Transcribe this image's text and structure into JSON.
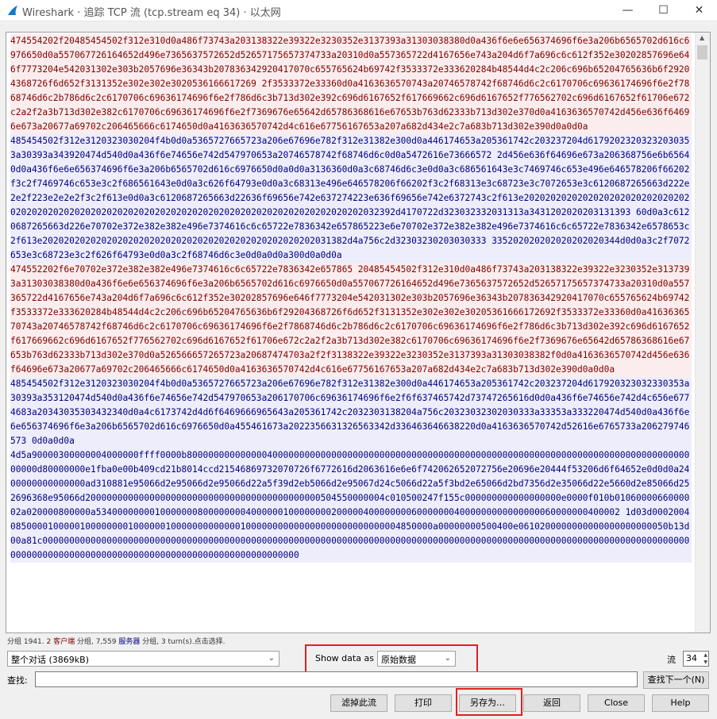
{
  "window": {
    "title": "Wireshark · 追踪 TCP 流 (tcp.stream eq 34) · 以太网",
    "minimize": "—",
    "maximize": "☐",
    "close": "✕"
  },
  "segments": [
    {
      "dir": "client",
      "text": "474554202f20485454502f312e310d0a486f73743a203138322e39322e3230352e3137393a31303038380d0a436f6e6e656374696f6e3a206b6565702d616c6976650d0a557067726164652d496e7365637572652d52657175657374733a20310d0a557365722d4167656e743a204d6f7a696c6c612f352e30202857696e646f7773204e542031302e303b2057696e36343b207836342920417070c655765624b69742f3533372e333620284b48544d4c2c206c696b65204765636b6f29204368726f6d652f3131352e302e302e3020536166617269 2f3533372e33360d0a4163636570743a20746578742f68746d6c2c6170706c69636174696f6e2f7868746d6c2b786d6c2c6170706c69636174696f6e2f786d6c3b713d302e392c696d6167652f617669662c696d6167652f776562702c696d6167652f61706e672c2a2f2a3b713d302e382c6170706c69636174696f6e2f7369676e65642d65786368616e67653b763d62333b713d302e370d0a4163636570742d456e636f64696e673a20677a69702c206465666c6174650d0a4163636570742d4c616e67756167653a207a682d434e2c7a683b713d302e390d0a0d0a"
    },
    {
      "dir": "server",
      "text": "485454502f312e3120323030204f4b0d0a5365727665723a206e67696e782f312e31382e300d0a446174653a205361742c203237204d61792023203232030353a30393a343920474d540d0a436f6e74656e742d547970653a20746578742f68746d6c0d0a5472616e73666572 2d456e636f64696e673a206368756e6b65640d0a436f6e6e656374696f6e3a206b6565702d616c6976650d0a0d0a3136360d0a3c68746d6c3e0d0a3c686561643e3c7469746c653e496e646578206f66202f3c2f7469746c653e3c2f686561643e0d0a3c626f64793e0d0a3c68313e496e646578206f66202f3c2f68313e3c68723e3c7072653e3c6120687265663d222e2e2f223e2e2e2f3c2f613e0d0a3c6120687265663d22636f69656e742e637274223e636f69656e742e6372743c2f613e2020202020202020202020202020202020202020202020202020202020202020202020202020202020202020202020202032392d4170722d323032332031313a3431202020203131393 60d0a3c6120687265663d226e70702e372e382e382e496e7374616c6c65722e7836342e657865223e6e70702e372e382e382e496e7374616c6c65722e7836342e6578653c2f613e202020202020202020202020202020202020202020202020202031382d4a756c2d32303230203030333 335202020202020202020344d0d0a3c2f7072653e3c68723e3c2f626f64793e0d0a3c2f68746d6c3e0d0a0d0a300d0a0d0a"
    },
    {
      "dir": "client",
      "text": "474552202f6e70702e372e382e382e496e7374616c6c65722e7836342e657865 20485454502f312e310d0a486f73743a203138322e39322e3230352e3137393a31303038380d0a436f6e6e656374696f6e3a206b6565702d616c6976650d0a557067726164652d496e7365637572652d52657175657374733a20310d0a557365722d4167656e743a204d6f7a696c6c612f352e30202857696e646f7773204e542031302e303b2057696e36343b207836342920417070c655765624b69742f3533372e333620284b48544d4c2c206c696b65204765636b6f29204368726f6d652f3131352e302e302e30205361666172692f3533372e33360d0a4163636570743a20746578742f68746d6c2c6170706c69636174696f6e2f7868746d6c2b786d6c2c6170706c69636174696f6e2f786d6c3b713d302e392c696d6167652f617669662c696d6167652f776562702c696d6167652f61706e672c2a2f2a3b713d302e382c6170706c69636174696f6e2f7369676e65642d65786368616e67653b763d62333b713d302e370d0a526566657265723a20687474703a2f2f3138322e39322e3230352e3137393a31303038382f0d0a4163636570742d456e636f64696e673a20677a69702c206465666c6174650d0a4163636570742d4c616e67756167653a207a682d434e2c7a683b713d302e390d0a0d0a"
    },
    {
      "dir": "server",
      "text": "485454502f312e3120323030204f4b0d0a5365727665723a206e67696e782f312e31382e300d0a446174653a205361742c203237204d617920323032330353a30393a353120474d540d0a436f6e74656e742d547970653a206170706c69636174696f6e2f6f637465742d73747265616d0d0a436f6e74656e742d4c656e6774683a20343035303432340d0a4c6173742d4d6f6469666965643a205361742c2032303138204a756c20323032302030333a33353a333220474d540d0a436f6e6e656374696f6e3a206b6565702d616c6976650d0a455461673a2022356631326563342d336463646638220d0a4163636570742d52616e6765733a206279746573 0d0a0d0a"
    },
    {
      "dir": "server",
      "text": "4d5a90000300000004000000ffff0000b800000000000000400000000000000000000000000000000000000000000000000000000000000000000000000000000000d80000000e1fba0e00b409cd21b8014ccd21546869732070726f6772616d2063616e6e6f742062652072756e20696e20444f53206d6f64652e0d0d0a2400000000000000ad310881e95066d2e95066d2e95066d22a5f39d2eb5066d2e95067d24c5066d22a5f3bd2e65066d2bd7356d2e35066d22e5660d2e85066d252696368e95066d20000000000000000000000000000000000000000000504550000004c010500247f155c000000000000000000e0000f010b0106000066000002a020000800000a53400000000100000008000000004000000100000000200000400000000600000004000000000000000060000000400002 1d03d00020040850000100000100000000100000010000000000000100000000000000000000000000004850000a00000000500400e0610200000000000000000000050b13d00a81c0000000000000000000000000000000000000000000000000000000000000000000000000000000000000000000000000000000000000000000000000000000000000000000000000000000000000000000000000000000"
    }
  ],
  "status": {
    "prefix": "分组 1941. ",
    "client_count": "2",
    "client_label": "客户端",
    "middle": " 分组, 7,559 ",
    "server_label": "服务器",
    "suffix": " 分组, 3 turn(s).点击选择."
  },
  "controls": {
    "conversation_value": "整个对话 (3869kB)",
    "show_data_as_label": "Show data as",
    "show_data_as_value": "原始数据",
    "stream_label": "流",
    "stream_value": "34",
    "find_label": "查找:",
    "find_value": "",
    "find_next_label": "查找下一个(N)"
  },
  "buttons": {
    "filter_out": "滤掉此流",
    "print": "打印",
    "save_as": "另存为…",
    "back": "返回",
    "close": "Close",
    "help": "Help"
  },
  "colors": {
    "client_fg": "#800000",
    "client_bg": "#fbeded",
    "server_fg": "#000080",
    "server_bg": "#ededfb",
    "highlight": "#e02020"
  }
}
